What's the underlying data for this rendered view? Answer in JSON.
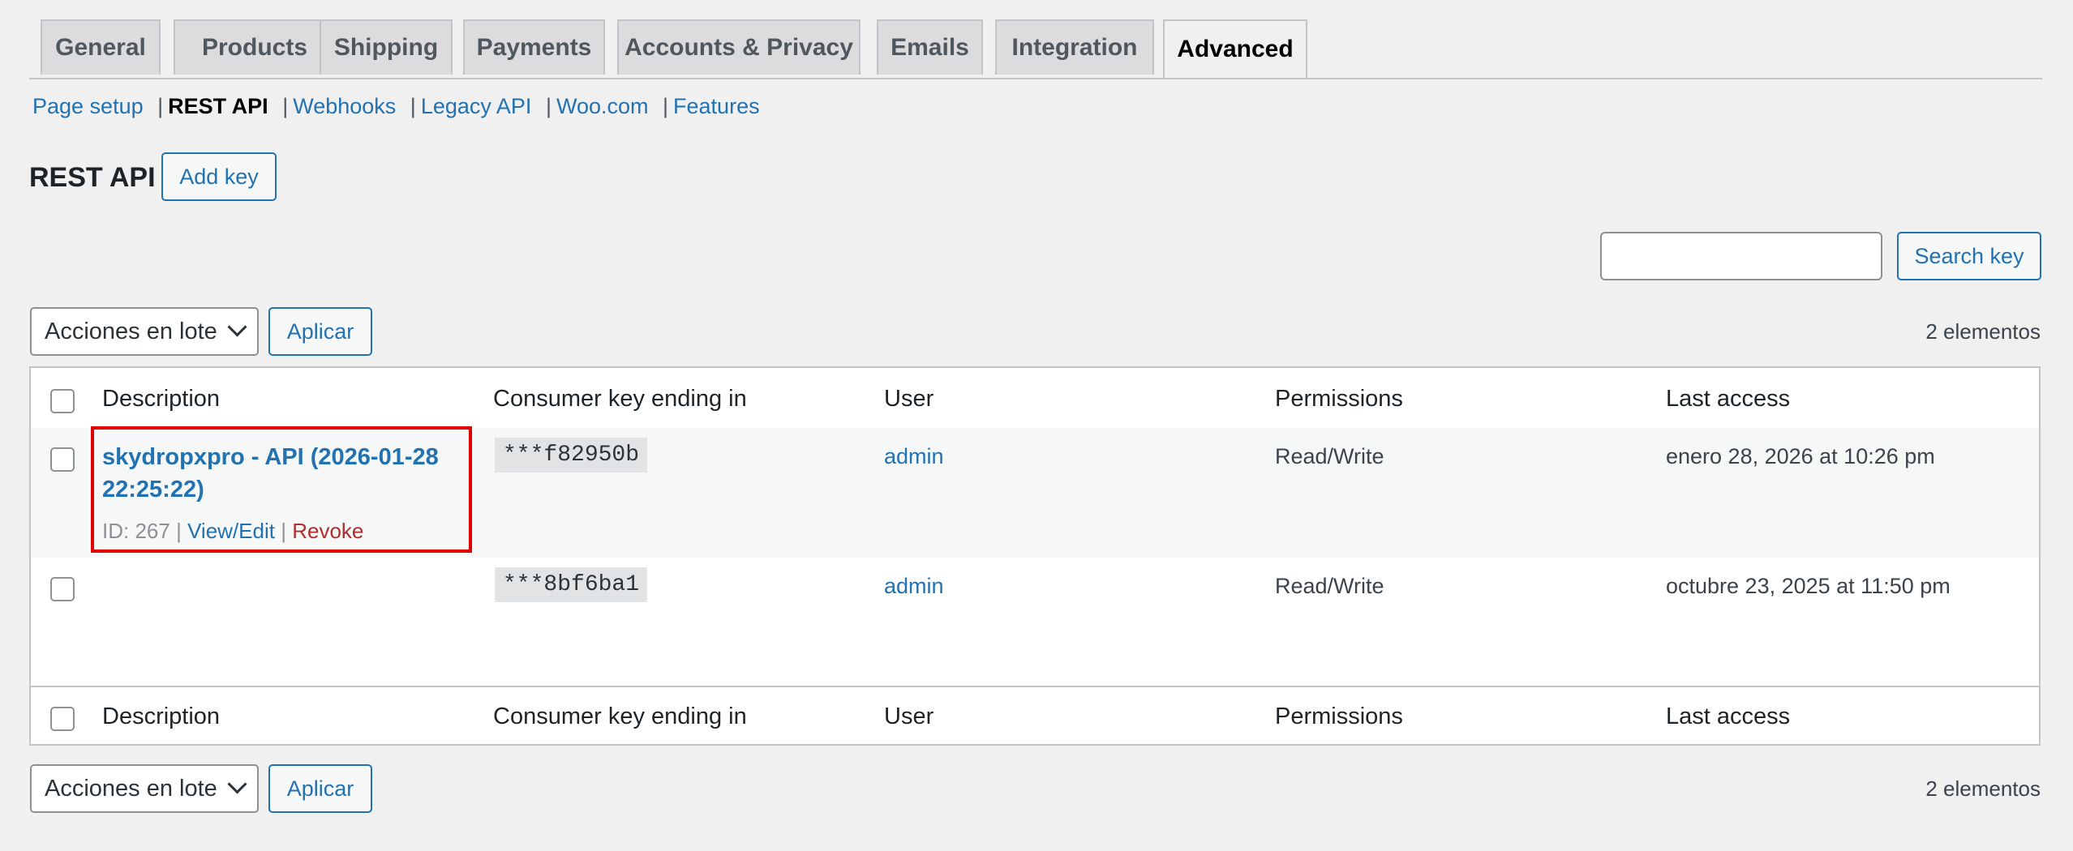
{
  "tabs": [
    {
      "label": "General"
    },
    {
      "label": "Products"
    },
    {
      "label": "Shipping"
    },
    {
      "label": "Payments"
    },
    {
      "label": "Accounts & Privacy"
    },
    {
      "label": "Emails"
    },
    {
      "label": "Integration"
    },
    {
      "label": "Advanced"
    }
  ],
  "subnav": {
    "items": [
      "Page setup",
      "REST API",
      "Webhooks",
      "Legacy API",
      "Woo.com",
      "Features"
    ],
    "separator": "|"
  },
  "page": {
    "title": "REST API",
    "add_key_label": "Add key",
    "search_button_label": "Search key",
    "search_value": ""
  },
  "bulk": {
    "select_label": "Acciones en lote",
    "apply_label": "Aplicar",
    "count_label": "2 elementos"
  },
  "table": {
    "columns": [
      "Description",
      "Consumer key ending in",
      "User",
      "Permissions",
      "Last access"
    ],
    "rows": [
      {
        "description": "skydropxpro - API (2026-01-28 22:25:22)",
        "id_label": "ID: 267",
        "action_edit": "View/Edit",
        "action_revoke": "Revoke",
        "action_sep": "|",
        "key": "***f82950b",
        "user": "admin",
        "permissions": "Read/Write",
        "last_access": "enero 28, 2026 at 10:26 pm"
      },
      {
        "description": "",
        "key": "***8bf6ba1",
        "user": "admin",
        "permissions": "Read/Write",
        "last_access": "octubre 23, 2025 at 11:50 pm"
      }
    ]
  },
  "colors": {
    "accent": "#2271b1",
    "danger": "#b32d2e",
    "highlight": "#e00000"
  }
}
